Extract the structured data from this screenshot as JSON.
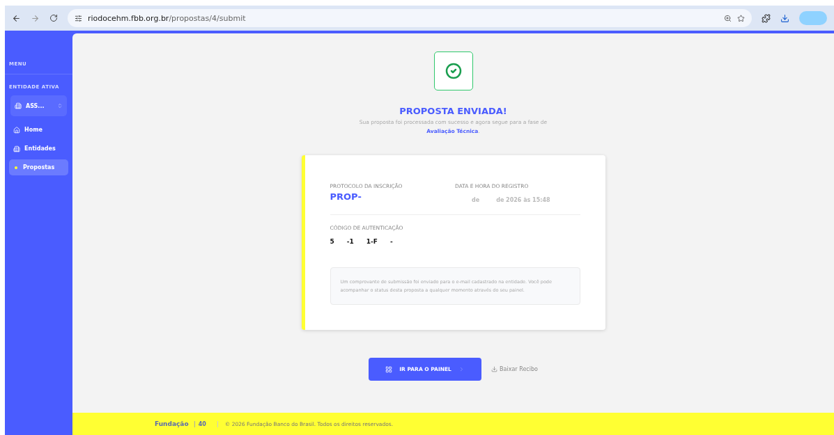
{
  "browser": {
    "url_host": "riodocehm.fbb.org.br",
    "url_path": "/propostas/4/submit"
  },
  "sidebar": {
    "menu_label": "MENU",
    "entity_label": "ENTIDADE ATIVA",
    "entity_name": "ASS...",
    "items": [
      {
        "label": "Home",
        "selected": false
      },
      {
        "label": "Entidades",
        "selected": false
      },
      {
        "label": "Propostas",
        "selected": true
      }
    ]
  },
  "success": {
    "title": "PROPOSTA ENVIADA!",
    "message": "Sua proposta foi processada com sucesso e agora segue para a fase de",
    "phase": "Avaliação Técnica",
    "period": "."
  },
  "card": {
    "protocol_label": "PROTOCOLO DA INSCRIÇÃO",
    "protocol_value": "PROP-",
    "date_label": "DATA E HORA DO REGISTRO",
    "date_parts": [
      "de",
      "de 2026 às 15:48"
    ],
    "auth_label": "CÓDIGO DE AUTENTICAÇÃO",
    "auth_parts": [
      "5",
      "-1",
      "1-F",
      "-"
    ],
    "notice": "Um comprovante de submissão foi enviado para o e-mail cadastrado na entidade. Você pode acompanhar o status desta proposta a qualquer momento através do seu painel."
  },
  "actions": {
    "primary": "IR PARA O PAINEL",
    "secondary": "Baixar Recibo"
  },
  "footer": {
    "brand": "Fundação",
    "badge": "40",
    "copyright": "© 2026 Fundação Banco do Brasil. Todos os direitos reservados."
  }
}
